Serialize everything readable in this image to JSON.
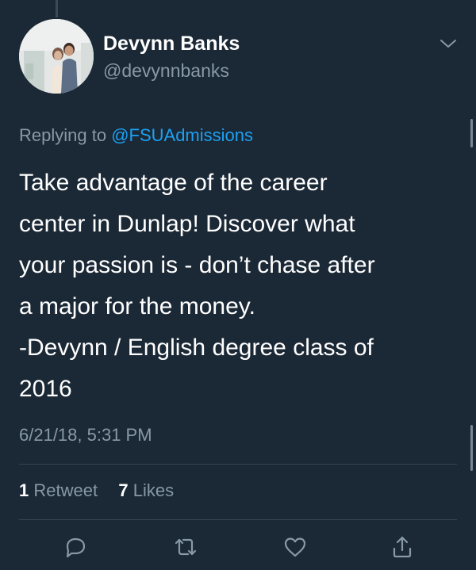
{
  "user": {
    "name": "Devynn Banks",
    "handle": "@devynnbanks"
  },
  "reply": {
    "prefix": "Replying to ",
    "mention": "@FSUAdmissions"
  },
  "tweet": {
    "lines": [
      "Take advantage of the career",
      "center in Dunlap! Discover what",
      "your passion is - don’t chase after",
      "a major for the money.",
      "-Devynn / English degree class of",
      "2016"
    ]
  },
  "timestamp": "6/21/18, 5:31 PM",
  "stats": {
    "retweets_count": "1",
    "retweets_label": "Retweet",
    "likes_count": "7",
    "likes_label": "Likes"
  },
  "icons": {
    "menu": "chevron-down-icon",
    "reply": "reply-icon",
    "retweet": "retweet-icon",
    "like": "heart-icon",
    "share": "share-icon"
  },
  "colors": {
    "background": "#1b2836",
    "text": "#ffffff",
    "secondary": "#8899a6",
    "accent": "#1da1f2",
    "divider": "#38444d"
  }
}
